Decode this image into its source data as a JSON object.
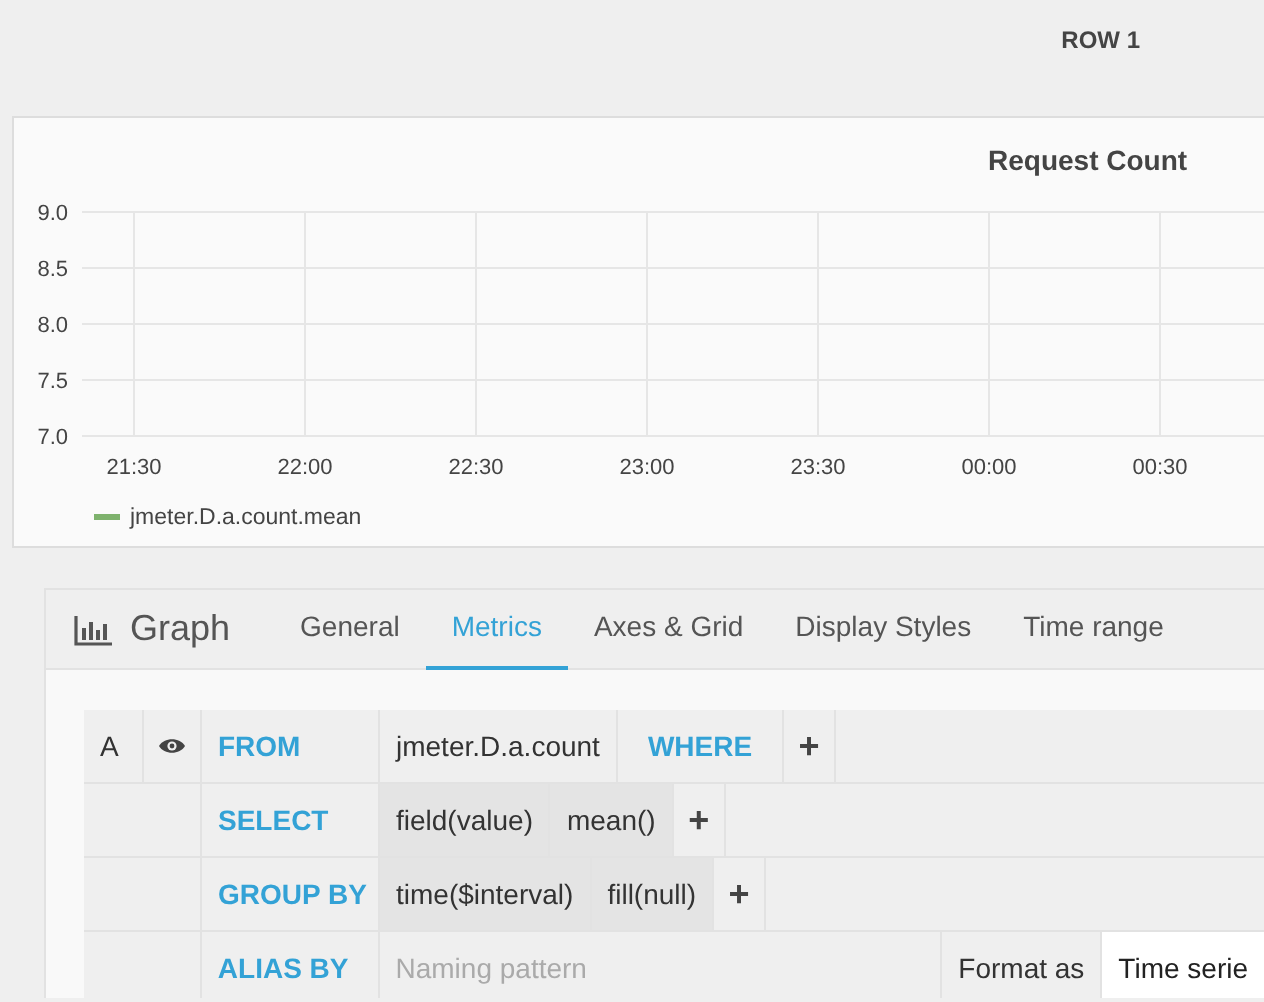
{
  "row": {
    "title": "ROW 1"
  },
  "panel": {
    "title": "Request Count",
    "chart_data": {
      "type": "line",
      "categories": [
        "21:30",
        "22:00",
        "22:30",
        "23:00",
        "23:30",
        "00:00",
        "00:30"
      ],
      "series": [
        {
          "name": "jmeter.D.a.count.mean",
          "color": "#7eb26d",
          "values": [
            null,
            null,
            null,
            null,
            null,
            null,
            null
          ]
        }
      ],
      "ylim": [
        7,
        9
      ],
      "grid": true,
      "yticks": [
        {
          "value": 9,
          "label": "9.0"
        },
        {
          "value": 8.5,
          "label": "8.5"
        },
        {
          "value": 8,
          "label": "8.0"
        },
        {
          "value": 7.5,
          "label": "7.5"
        },
        {
          "value": 7,
          "label": "7.0"
        }
      ]
    }
  },
  "editor": {
    "panel_type": "Graph",
    "tabs": [
      {
        "label": "General",
        "selected": false
      },
      {
        "label": "Metrics",
        "selected": true
      },
      {
        "label": "Axes & Grid",
        "selected": false
      },
      {
        "label": "Display Styles",
        "selected": false
      },
      {
        "label": "Time range",
        "selected": false
      }
    ],
    "query": {
      "ref": "A",
      "visible": true,
      "rows": [
        {
          "keyword": "FROM",
          "items": [
            {
              "kind": "plain",
              "text": "jmeter.D.a.count"
            },
            {
              "kind": "keyword",
              "text": "WHERE"
            },
            {
              "kind": "add",
              "text": "+"
            }
          ]
        },
        {
          "keyword": "SELECT",
          "items": [
            {
              "kind": "part",
              "text": "field(value)"
            },
            {
              "kind": "part",
              "text": "mean()"
            },
            {
              "kind": "add",
              "text": "+"
            }
          ]
        },
        {
          "keyword": "GROUP BY",
          "items": [
            {
              "kind": "part",
              "text": "time($interval)"
            },
            {
              "kind": "part",
              "text": "fill(null)"
            },
            {
              "kind": "add",
              "text": "+"
            }
          ]
        },
        {
          "keyword": "ALIAS BY",
          "items": [
            {
              "kind": "input",
              "placeholder": "Naming pattern"
            },
            {
              "kind": "label",
              "text": "Format as"
            },
            {
              "kind": "select",
              "text": "Time serie"
            }
          ]
        }
      ]
    }
  }
}
